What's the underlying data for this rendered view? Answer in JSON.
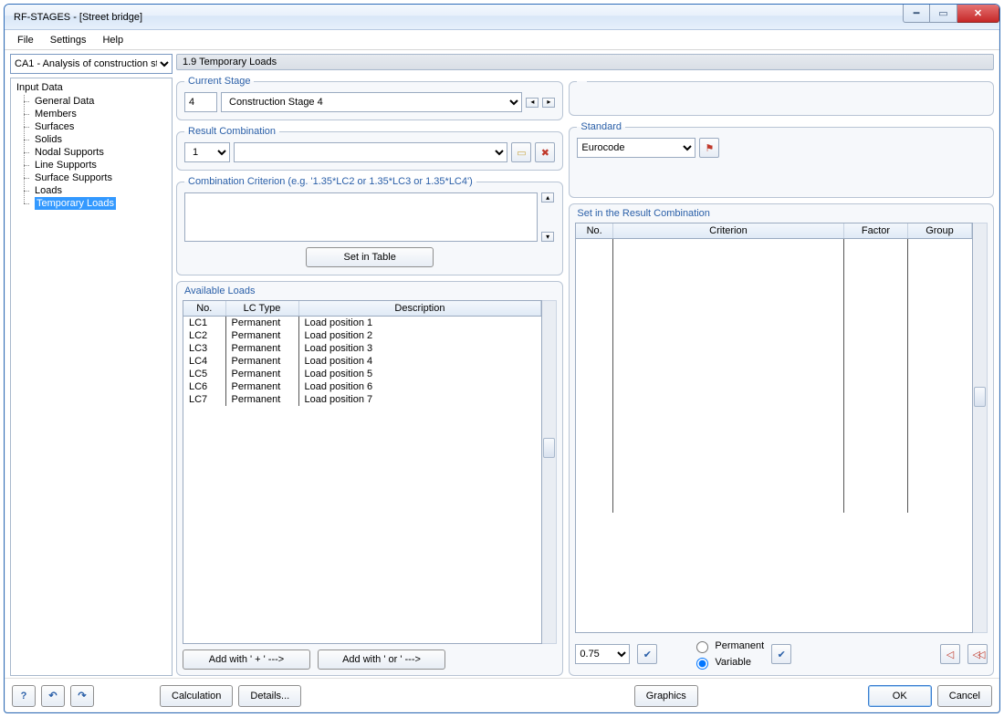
{
  "window": {
    "title": "RF-STAGES - [Street bridge]"
  },
  "menu": {
    "file": "File",
    "settings": "Settings",
    "help": "Help"
  },
  "sidebar": {
    "case_selector": "CA1 - Analysis of construction st",
    "root": "Input Data",
    "items": [
      {
        "label": "General Data"
      },
      {
        "label": "Members"
      },
      {
        "label": "Surfaces"
      },
      {
        "label": "Solids"
      },
      {
        "label": "Nodal Supports"
      },
      {
        "label": "Line Supports"
      },
      {
        "label": "Surface Supports"
      },
      {
        "label": "Loads"
      },
      {
        "label": "Temporary Loads",
        "selected": true
      }
    ]
  },
  "content_title": "1.9 Temporary Loads",
  "current_stage": {
    "legend": "Current Stage",
    "number": "4",
    "name": "Construction Stage 4"
  },
  "result_combination": {
    "legend": "Result Combination",
    "number": "1",
    "name": ""
  },
  "criterion": {
    "legend": "Combination Criterion (e.g. '1.35*LC2 or 1.35*LC3 or 1.35*LC4')",
    "value": "",
    "set_button": "Set in Table"
  },
  "standard": {
    "legend": "Standard",
    "value": "Eurocode"
  },
  "available": {
    "title": "Available Loads",
    "headers": {
      "no": "No.",
      "lctype": "LC Type",
      "desc": "Description"
    },
    "rows": [
      {
        "no": "LC1",
        "lctype": "Permanent",
        "desc": "Load position 1"
      },
      {
        "no": "LC2",
        "lctype": "Permanent",
        "desc": "Load position 2"
      },
      {
        "no": "LC3",
        "lctype": "Permanent",
        "desc": "Load position 3"
      },
      {
        "no": "LC4",
        "lctype": "Permanent",
        "desc": "Load position 4"
      },
      {
        "no": "LC5",
        "lctype": "Permanent",
        "desc": "Load position 5"
      },
      {
        "no": "LC6",
        "lctype": "Permanent",
        "desc": "Load position 6"
      },
      {
        "no": "LC7",
        "lctype": "Permanent",
        "desc": "Load position 7"
      }
    ],
    "add_plus": "Add with ' + ' --->",
    "add_or": "Add with ' or ' --->"
  },
  "result_table": {
    "title": "Set in the Result Combination",
    "headers": {
      "no": "No.",
      "criterion": "Criterion",
      "factor": "Factor",
      "group": "Group"
    },
    "factor_value": "0.75",
    "radio_permanent": "Permanent",
    "radio_variable": "Variable"
  },
  "footer": {
    "calculation": "Calculation",
    "details": "Details...",
    "graphics": "Graphics",
    "ok": "OK",
    "cancel": "Cancel"
  }
}
